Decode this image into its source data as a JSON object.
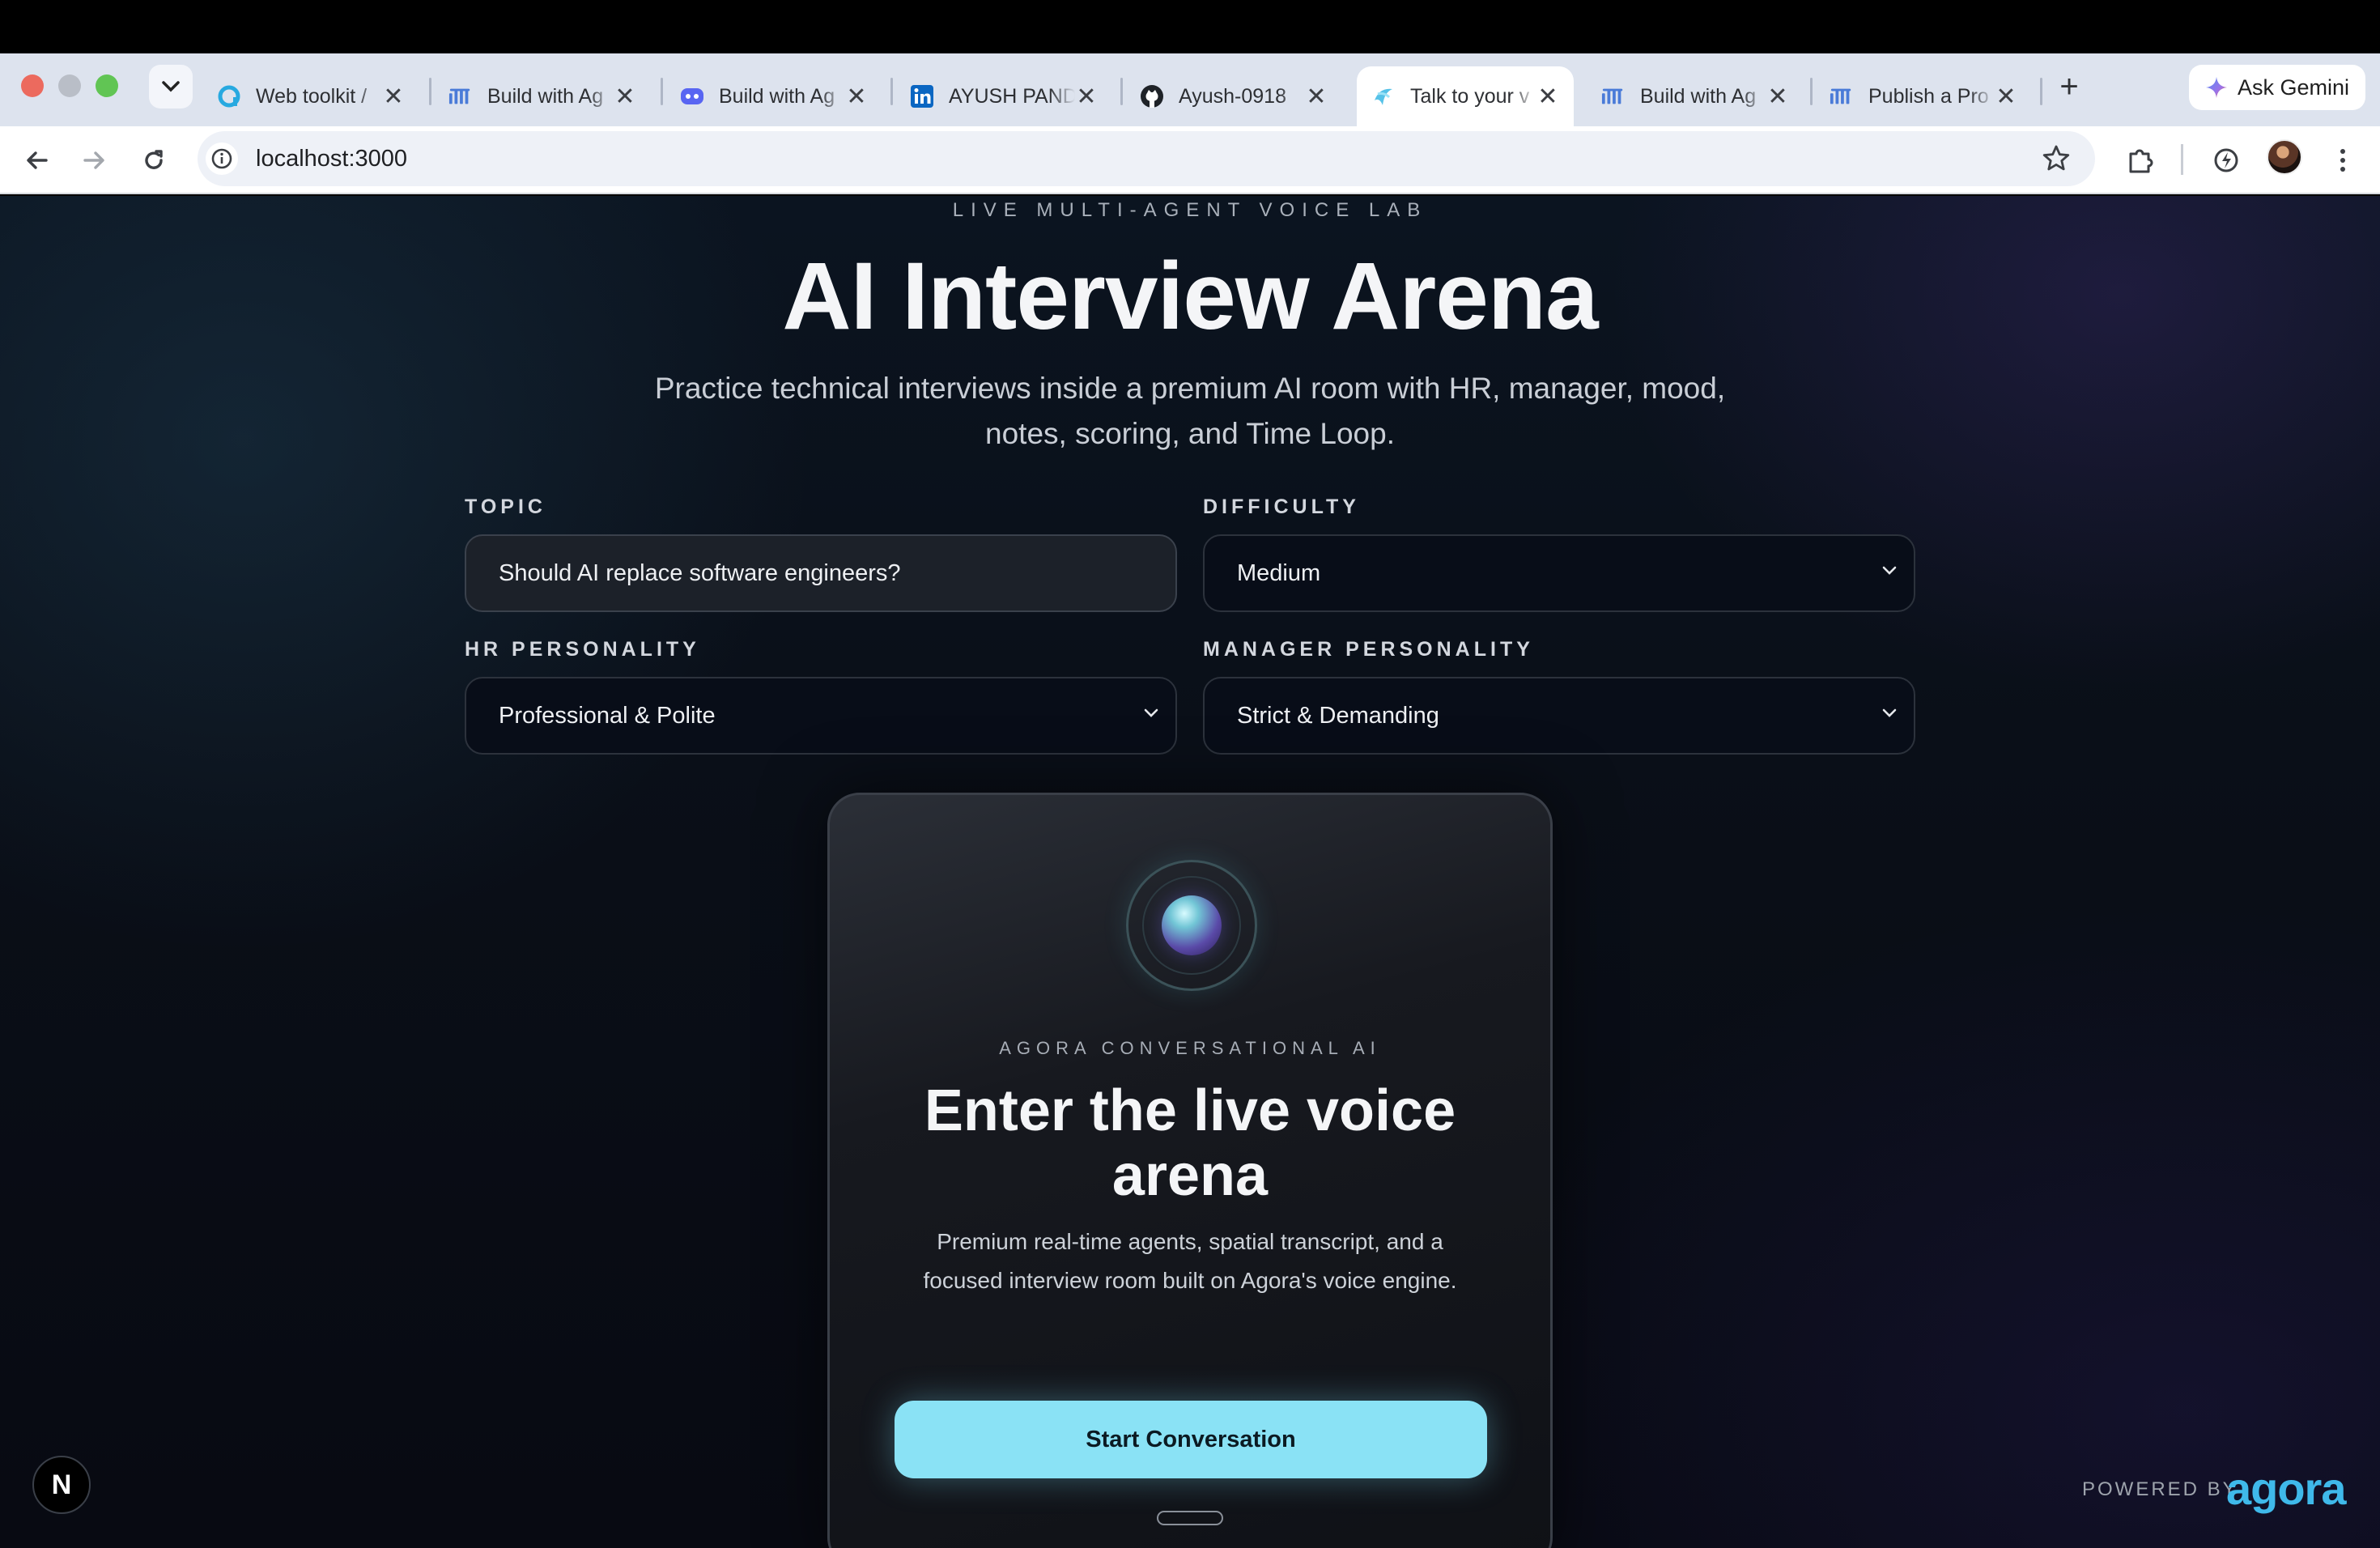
{
  "browser": {
    "tabs": [
      {
        "title": "Web toolkit / ",
        "icon": "agora-toolkit-icon",
        "active": false
      },
      {
        "title": "Build with Ag",
        "icon": "agora-docs-icon",
        "active": false
      },
      {
        "title": "Build with Ag",
        "icon": "discord-icon",
        "active": false
      },
      {
        "title": "AYUSH PANDEY",
        "icon": "linkedin-icon",
        "active": false
      },
      {
        "title": "Ayush-0918",
        "icon": "github-icon",
        "active": false
      },
      {
        "title": "Talk to your v",
        "icon": "app-icon",
        "active": true
      },
      {
        "title": "Build with Ag",
        "icon": "agora-docs-icon",
        "active": false
      },
      {
        "title": "Publish a Pro",
        "icon": "agora-docs-icon",
        "active": false
      }
    ],
    "gemini_label": "Ask Gemini",
    "url": "localhost:3000"
  },
  "page": {
    "eyebrow": "LIVE MULTI-AGENT VOICE LAB",
    "title": "AI Interview Arena",
    "subtitle": "Practice technical interviews inside a premium AI room with HR, manager, mood, notes, scoring, and Time Loop.",
    "form": {
      "topic_label": "TOPIC",
      "topic_value": "Should AI replace software engineers?",
      "difficulty_label": "DIFFICULTY",
      "difficulty_value": "Medium",
      "hr_label": "HR PERSONALITY",
      "hr_value": "Professional & Polite",
      "manager_label": "MANAGER PERSONALITY",
      "manager_value": "Strict & Demanding"
    },
    "card": {
      "eyebrow": "AGORA CONVERSATIONAL AI",
      "title": "Enter the live voice arena",
      "description": "Premium real-time agents, spatial transcript, and a focused interview room built on Agora's voice engine.",
      "button": "Start Conversation"
    },
    "next_badge": "N",
    "powered_by": "POWERED BY",
    "brand": "agora"
  },
  "colors": {
    "accent": "#8ae2f5",
    "brand": "#3fb9ea",
    "background": "#0a0f18"
  }
}
